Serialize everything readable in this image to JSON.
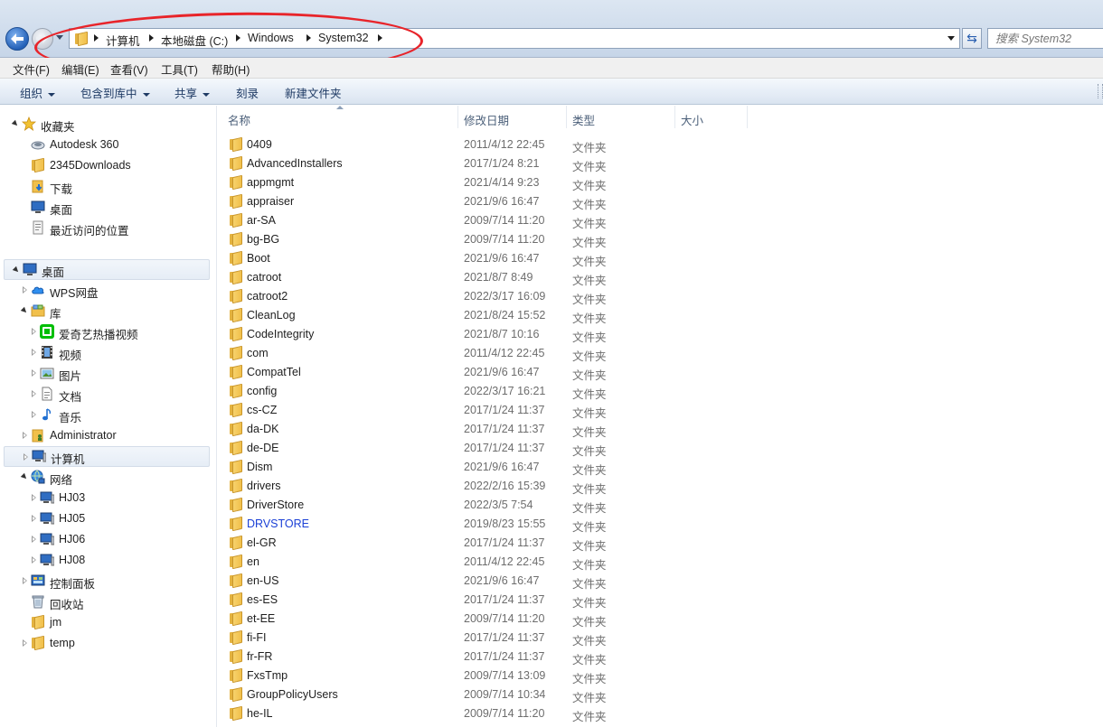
{
  "address": {
    "crumbs": [
      "计算机",
      "本地磁盘 (C:)",
      "Windows",
      "System32"
    ],
    "search_placeholder": "搜索 System32"
  },
  "menu": [
    "文件(F)",
    "编辑(E)",
    "查看(V)",
    "工具(T)",
    "帮助(H)"
  ],
  "commands": [
    {
      "label": "组织",
      "dropdown": true
    },
    {
      "label": "包含到库中",
      "dropdown": true
    },
    {
      "label": "共享",
      "dropdown": true
    },
    {
      "label": "刻录",
      "dropdown": false
    },
    {
      "label": "新建文件夹",
      "dropdown": false
    }
  ],
  "nav": {
    "favorites": {
      "label": "收藏夹",
      "items": [
        "Autodesk 360",
        "2345Downloads",
        "下载",
        "桌面",
        "最近访问的位置"
      ]
    },
    "desktop": "桌面",
    "wps": "WPS网盘",
    "library": {
      "label": "库",
      "items": [
        "爱奇艺热播视频",
        "视频",
        "图片",
        "文档",
        "音乐"
      ]
    },
    "administrator": "Administrator",
    "computer": "计算机",
    "network": {
      "label": "网络",
      "items": [
        "HJ03",
        "HJ05",
        "HJ06",
        "HJ08"
      ]
    },
    "control_panel": "控制面板",
    "recycle_bin": "回收站",
    "jm": "jm",
    "temp": "temp"
  },
  "columns": {
    "name": "名称",
    "date": "修改日期",
    "type": "类型",
    "size": "大小"
  },
  "files": [
    {
      "name": "0409",
      "date": "2011/4/12 22:45",
      "type": "文件夹"
    },
    {
      "name": "AdvancedInstallers",
      "date": "2017/1/24 8:21",
      "type": "文件夹"
    },
    {
      "name": "appmgmt",
      "date": "2021/4/14 9:23",
      "type": "文件夹"
    },
    {
      "name": "appraiser",
      "date": "2021/9/6 16:47",
      "type": "文件夹"
    },
    {
      "name": "ar-SA",
      "date": "2009/7/14 11:20",
      "type": "文件夹"
    },
    {
      "name": "bg-BG",
      "date": "2009/7/14 11:20",
      "type": "文件夹"
    },
    {
      "name": "Boot",
      "date": "2021/9/6 16:47",
      "type": "文件夹"
    },
    {
      "name": "catroot",
      "date": "2021/8/7 8:49",
      "type": "文件夹"
    },
    {
      "name": "catroot2",
      "date": "2022/3/17 16:09",
      "type": "文件夹"
    },
    {
      "name": "CleanLog",
      "date": "2021/8/24 15:52",
      "type": "文件夹"
    },
    {
      "name": "CodeIntegrity",
      "date": "2021/8/7 10:16",
      "type": "文件夹"
    },
    {
      "name": "com",
      "date": "2011/4/12 22:45",
      "type": "文件夹"
    },
    {
      "name": "CompatTel",
      "date": "2021/9/6 16:47",
      "type": "文件夹"
    },
    {
      "name": "config",
      "date": "2022/3/17 16:21",
      "type": "文件夹"
    },
    {
      "name": "cs-CZ",
      "date": "2017/1/24 11:37",
      "type": "文件夹"
    },
    {
      "name": "da-DK",
      "date": "2017/1/24 11:37",
      "type": "文件夹"
    },
    {
      "name": "de-DE",
      "date": "2017/1/24 11:37",
      "type": "文件夹"
    },
    {
      "name": "Dism",
      "date": "2021/9/6 16:47",
      "type": "文件夹"
    },
    {
      "name": "drivers",
      "date": "2022/2/16 15:39",
      "type": "文件夹"
    },
    {
      "name": "DriverStore",
      "date": "2022/3/5 7:54",
      "type": "文件夹"
    },
    {
      "name": "DRVSTORE",
      "date": "2019/8/23 15:55",
      "type": "文件夹",
      "highlight": true
    },
    {
      "name": "el-GR",
      "date": "2017/1/24 11:37",
      "type": "文件夹"
    },
    {
      "name": "en",
      "date": "2011/4/12 22:45",
      "type": "文件夹"
    },
    {
      "name": "en-US",
      "date": "2021/9/6 16:47",
      "type": "文件夹"
    },
    {
      "name": "es-ES",
      "date": "2017/1/24 11:37",
      "type": "文件夹"
    },
    {
      "name": "et-EE",
      "date": "2009/7/14 11:20",
      "type": "文件夹"
    },
    {
      "name": "fi-FI",
      "date": "2017/1/24 11:37",
      "type": "文件夹"
    },
    {
      "name": "fr-FR",
      "date": "2017/1/24 11:37",
      "type": "文件夹"
    },
    {
      "name": "FxsTmp",
      "date": "2009/7/14 13:09",
      "type": "文件夹"
    },
    {
      "name": "GroupPolicyUsers",
      "date": "2009/7/14 10:34",
      "type": "文件夹"
    },
    {
      "name": "he-IL",
      "date": "2009/7/14 11:20",
      "type": "文件夹"
    }
  ],
  "colors": {
    "accent": "#2461b8",
    "annotation": "#e8242a",
    "link": "#1a3fd6"
  }
}
